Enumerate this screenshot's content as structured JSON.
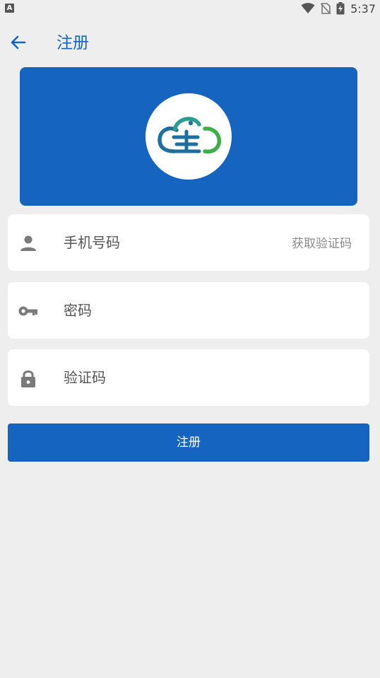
{
  "status_bar": {
    "notification_icon": "A",
    "time": "5:37",
    "icons": [
      "wifi-icon",
      "no-sim-icon",
      "battery-charging-icon"
    ]
  },
  "header": {
    "back_icon": "arrow-left-icon",
    "title": "注册"
  },
  "banner": {
    "background_color": "#1565c0",
    "logo_icon": "cloud-logo-icon"
  },
  "form": {
    "phone": {
      "icon": "person-icon",
      "placeholder": "手机号码",
      "get_code_label": "获取验证码"
    },
    "password": {
      "icon": "key-icon",
      "placeholder": "密码"
    },
    "code": {
      "icon": "lock-icon",
      "placeholder": "验证码"
    },
    "submit_label": "注册"
  },
  "colors": {
    "accent": "#1565c0",
    "background": "#eeeeee",
    "card": "#ffffff",
    "placeholder": "#555555",
    "muted": "#8a8a8a"
  }
}
